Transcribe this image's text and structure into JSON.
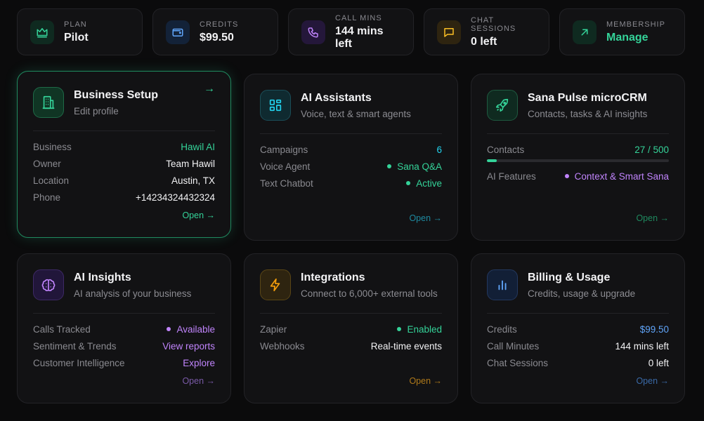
{
  "stats": [
    {
      "label": "PLAN",
      "value": "Pilot",
      "icon": "crown-icon",
      "color": "#34d399",
      "bg": "#0f2a20"
    },
    {
      "label": "CREDITS",
      "value": "$99.50",
      "icon": "wallet-icon",
      "color": "#60a5fa",
      "bg": "#132238"
    },
    {
      "label": "CALL MINS",
      "value": "144 mins left",
      "icon": "phone-icon",
      "color": "#c084fc",
      "bg": "#24173a"
    },
    {
      "label": "CHAT SESSIONS",
      "value": "0 left",
      "icon": "chat-icon",
      "color": "#fbbf24",
      "bg": "#2e2410"
    },
    {
      "label": "MEMBERSHIP",
      "value": "Manage",
      "icon": "arrow-up-right-icon",
      "color": "#34d399",
      "bg": "#0f2a20"
    }
  ],
  "cards": {
    "business": {
      "title": "Business Setup",
      "subtitle": "Edit profile",
      "arrow": "→",
      "rows": [
        {
          "label": "Business",
          "value": "Hawil AI"
        },
        {
          "label": "Owner",
          "value": "Team Hawil"
        },
        {
          "label": "Location",
          "value": "Austin, TX"
        },
        {
          "label": "Phone",
          "value": "+14234324432324"
        }
      ],
      "open": "Open →"
    },
    "assistants": {
      "title": "AI Assistants",
      "subtitle": "Voice, text & smart agents",
      "rows": [
        {
          "label": "Campaigns",
          "value": "6"
        },
        {
          "label": "Voice Agent",
          "value": "Sana Q&A"
        },
        {
          "label": "Text Chatbot",
          "value": "Active"
        }
      ],
      "open": "Open →"
    },
    "crm": {
      "title": "Sana Pulse microCRM",
      "subtitle": "Contacts, tasks & AI insights",
      "contacts_label": "Contacts",
      "contacts_value": "27 / 500",
      "contacts_progress": 0.054,
      "features_label": "AI Features",
      "features_value": "Context & Smart Sana",
      "open": "Open →"
    },
    "insights": {
      "title": "AI Insights",
      "subtitle": "AI analysis of your business",
      "rows": [
        {
          "label": "Calls Tracked",
          "value": "Available"
        },
        {
          "label": "Sentiment & Trends",
          "value": "View reports"
        },
        {
          "label": "Customer Intelligence",
          "value": "Explore"
        }
      ],
      "open": "Open →"
    },
    "integrations": {
      "title": "Integrations",
      "subtitle": "Connect to 6,000+ external tools",
      "rows": [
        {
          "label": "Zapier",
          "value": "Enabled"
        },
        {
          "label": "Webhooks",
          "value": "Real-time events"
        }
      ],
      "open": "Open →"
    },
    "billing": {
      "title": "Billing & Usage",
      "subtitle": "Credits, usage & upgrade",
      "rows": [
        {
          "label": "Credits",
          "value": "$99.50"
        },
        {
          "label": "Call Minutes",
          "value": "144 mins left"
        },
        {
          "label": "Chat Sessions",
          "value": "0 left"
        }
      ],
      "open": "Open →"
    }
  },
  "colors": {
    "green": "#34d399",
    "cyan": "#22d3ee",
    "purple": "#c084fc",
    "amber": "#f59e0b",
    "blue": "#60a5fa"
  }
}
